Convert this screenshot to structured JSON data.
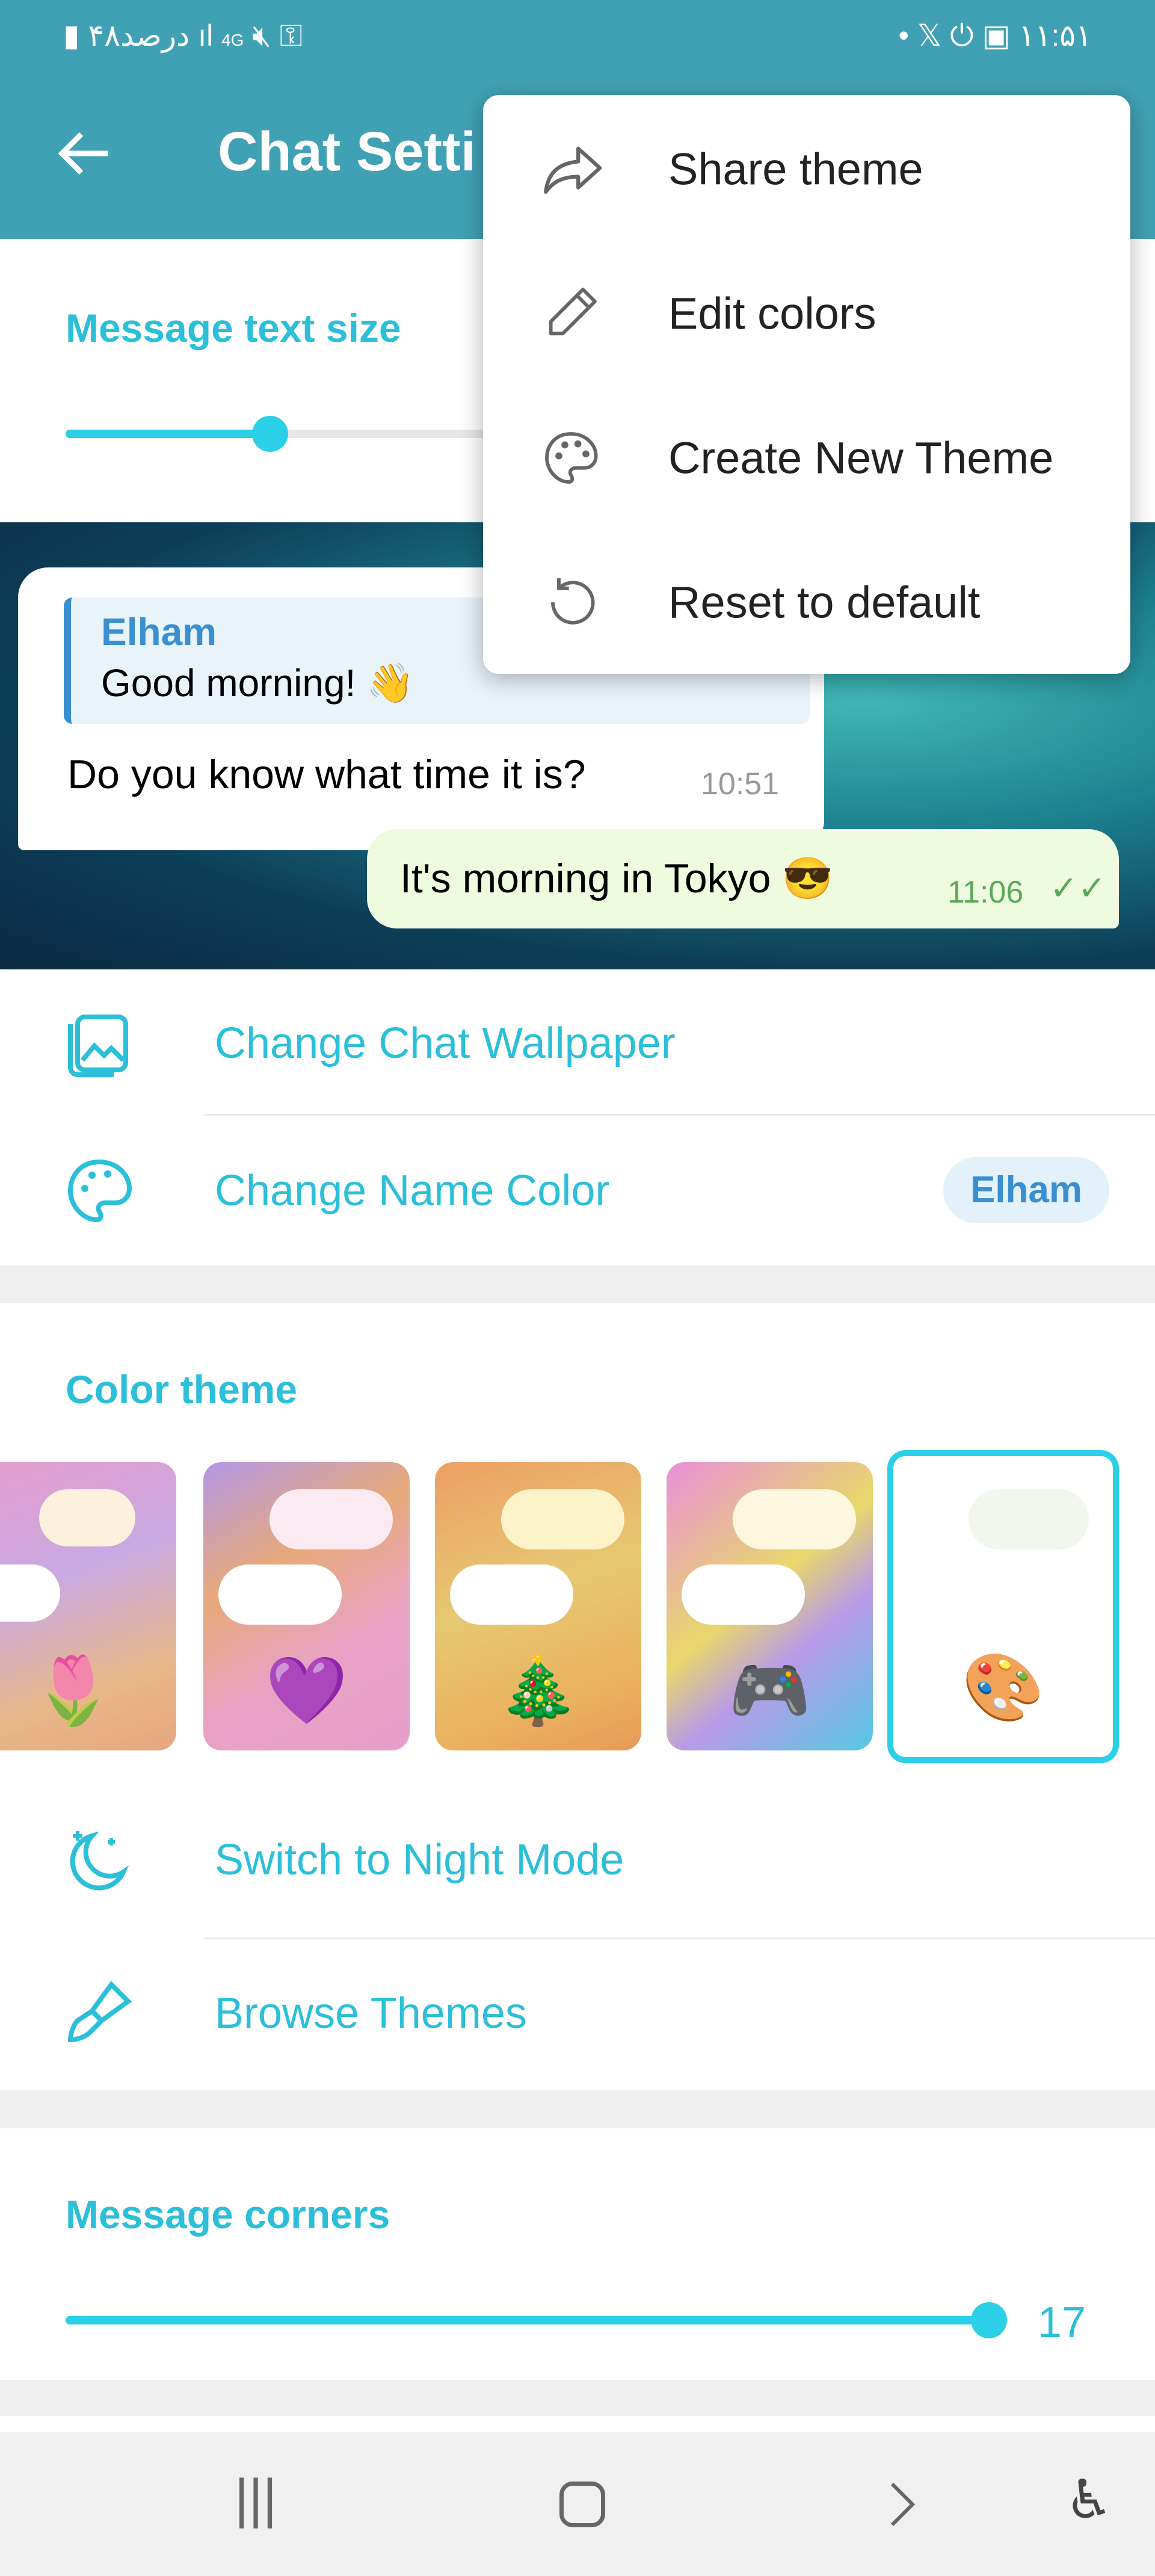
{
  "status_bar": {
    "battery_text": "۴۸درصد",
    "network": "4G",
    "time": "۱۱:۵۱"
  },
  "header": {
    "title": "Chat Setti",
    "back": "arrow-left-icon"
  },
  "menu": {
    "items": [
      {
        "label": "Share theme",
        "icon": "share-icon"
      },
      {
        "label": "Edit colors",
        "icon": "pencil-icon"
      },
      {
        "label": "Create New Theme",
        "icon": "palette-icon"
      },
      {
        "label": "Reset to default",
        "icon": "reset-icon"
      }
    ]
  },
  "text_size": {
    "label": "Message text size",
    "value_fraction": 0.2
  },
  "chat_preview": {
    "reply_name": "Elham",
    "reply_text": "Good morning! 👋",
    "incoming_text": "Do you know what time it is?",
    "incoming_time": "10:51",
    "outgoing_text": "It's morning in Tokyo 😎",
    "outgoing_time": "11:06"
  },
  "rows": {
    "wallpaper": "Change Chat Wallpaper",
    "name_color": "Change Name Color",
    "name_badge": "Elham",
    "night_mode": "Switch to Night Mode",
    "browse": "Browse Themes"
  },
  "color_theme": {
    "label": "Color theme",
    "themes": [
      {
        "emoji": "🌷"
      },
      {
        "emoji": "💜"
      },
      {
        "emoji": "🎄"
      },
      {
        "emoji": "🎮"
      },
      {
        "emoji": "🎨",
        "selected": true
      }
    ]
  },
  "corners": {
    "label": "Message corners",
    "value": "17"
  },
  "colors": {
    "header": "#41a1b4",
    "accent": "#2bcfe8"
  }
}
